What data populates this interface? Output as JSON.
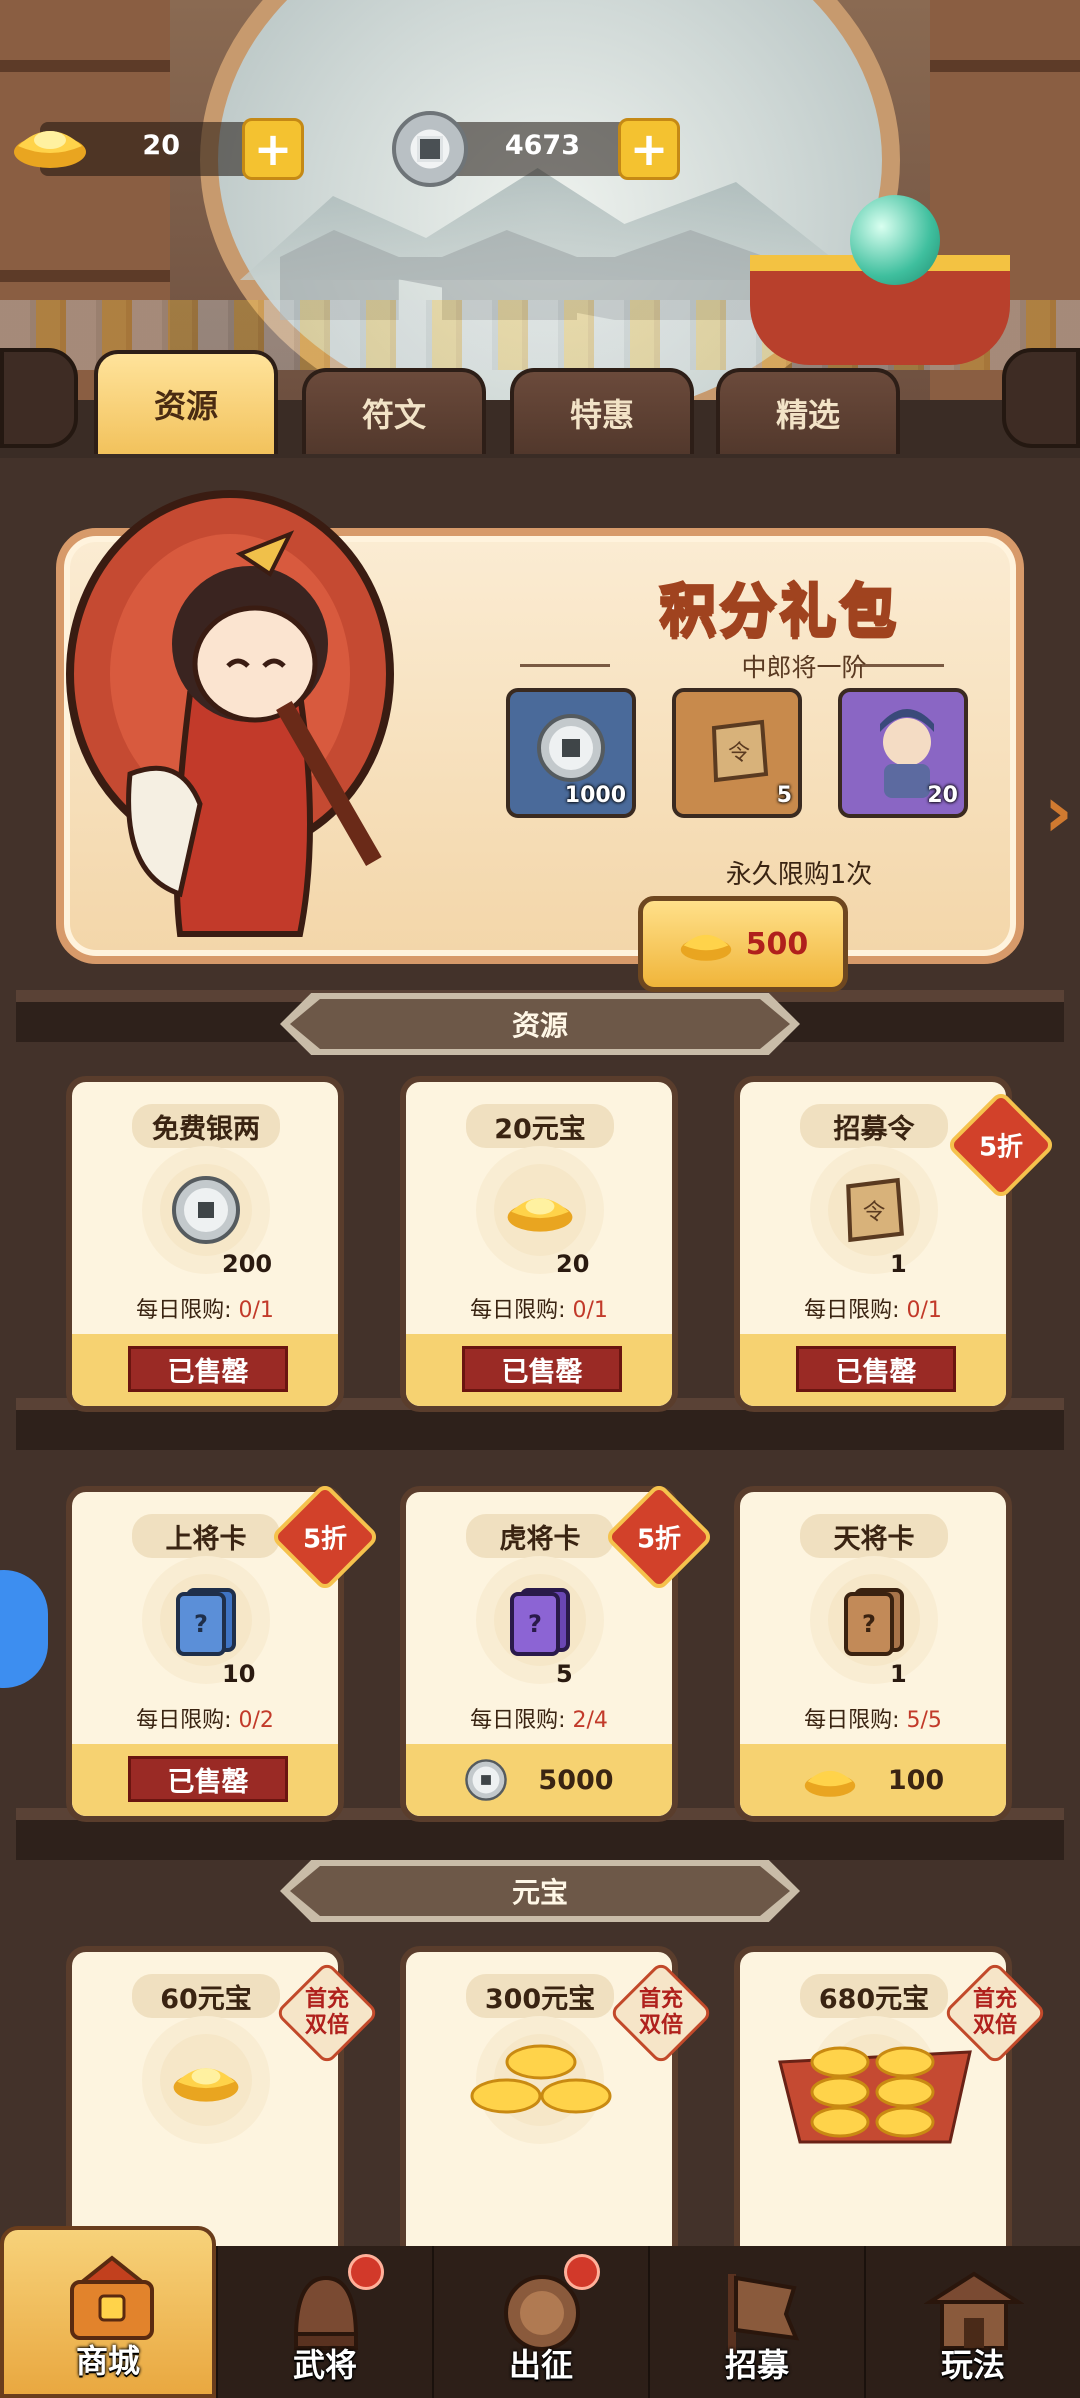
{
  "currency": {
    "gold": "20",
    "silver": "4673"
  },
  "tabs": [
    {
      "label": "资源",
      "active": true
    },
    {
      "label": "符文",
      "active": false
    },
    {
      "label": "特惠",
      "active": false
    },
    {
      "label": "精选",
      "active": false
    }
  ],
  "gift": {
    "title": "积分礼包",
    "subtitle": "中郎将一阶",
    "rewards": [
      {
        "qty": "1000",
        "icon": "silver-coin-icon"
      },
      {
        "qty": "5",
        "icon": "recruit-token-icon"
      },
      {
        "qty": "20",
        "icon": "general-portrait-icon"
      }
    ],
    "limit": "永久限购1次",
    "price": "500"
  },
  "sections": {
    "resources": "资源",
    "yuanbao": "元宝"
  },
  "cards": [
    {
      "name": "免费银两",
      "count": "200",
      "limit_label": "每日限购:",
      "limit_value": "0/1",
      "action": "已售罄"
    },
    {
      "name": "20元宝",
      "count": "20",
      "limit_label": "每日限购:",
      "limit_value": "0/1",
      "action": "已售罄"
    },
    {
      "name": "招募令",
      "count": "1",
      "limit_label": "每日限购:",
      "limit_value": "0/1",
      "action": "已售罄",
      "discount": "5折"
    },
    {
      "name": "上将卡",
      "count": "10",
      "limit_label": "每日限购:",
      "limit_value": "0/2",
      "action": "已售罄",
      "discount": "5折"
    },
    {
      "name": "虎将卡",
      "count": "5",
      "limit_label": "每日限购:",
      "limit_value": "2/4",
      "price": "5000",
      "discount": "5折"
    },
    {
      "name": "天将卡",
      "count": "1",
      "limit_label": "每日限购:",
      "limit_value": "5/5",
      "price": "100"
    },
    {
      "name": "60元宝",
      "badge": "首充双倍"
    },
    {
      "name": "300元宝",
      "badge": "首充双倍"
    },
    {
      "name": "680元宝",
      "badge": "首充双倍"
    }
  ],
  "nav": [
    {
      "label": "商城",
      "active": true
    },
    {
      "label": "武将",
      "dot": true
    },
    {
      "label": "出征",
      "dot": true
    },
    {
      "label": "招募"
    },
    {
      "label": "玩法"
    }
  ],
  "colors": {
    "accent_gold": "#f4c230",
    "sold_red": "#9a2a25",
    "limit_red": "#c23a2a"
  }
}
